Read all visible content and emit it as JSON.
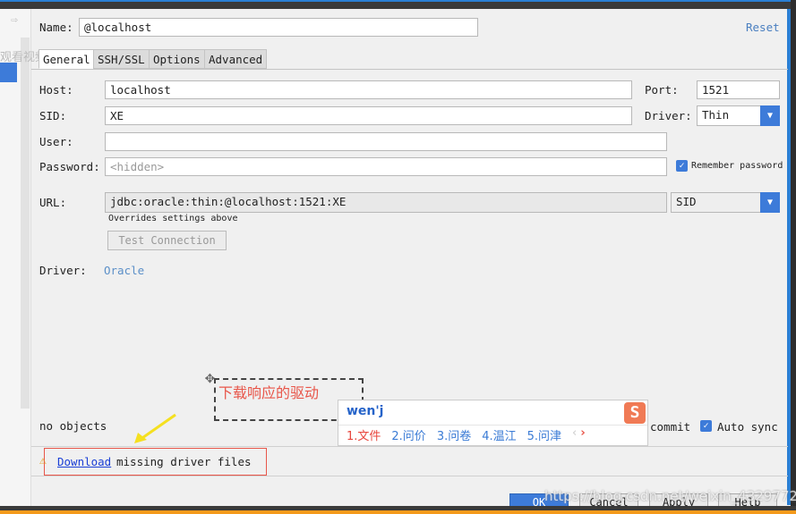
{
  "name": {
    "label": "Name:",
    "value": "@localhost",
    "reset": "Reset"
  },
  "tabs": [
    {
      "label": "General"
    },
    {
      "label": "SSH/SSL"
    },
    {
      "label": "Options"
    },
    {
      "label": "Advanced"
    }
  ],
  "watermark_left": "观看视频",
  "form": {
    "host_label": "Host:",
    "host": "localhost",
    "port_label": "Port:",
    "port": "1521",
    "sid_label": "SID:",
    "sid": "XE",
    "driver_label": "Driver:",
    "driver": "Thin",
    "user_label": "User:",
    "user": "",
    "password_label": "Password:",
    "password_placeholder": "<hidden>",
    "remember": "Remember password",
    "url_label": "URL:",
    "url": "jdbc:oracle:thin:@localhost:1521:XE",
    "url_type": "SID",
    "overrides": "Overrides settings above",
    "test": "Test Connection",
    "driver2_label": "Driver:",
    "driver2": "Oracle"
  },
  "annotation": "下载响应的驱动",
  "ime": {
    "input": "wen'j",
    "candidates": [
      "1.文件",
      "2.问价",
      "3.问卷",
      "4.温江",
      "5.问津"
    ]
  },
  "no_objects": "no objects",
  "commit": "commit",
  "auto_sync": "Auto sync",
  "download": {
    "link": "Download",
    "text": "missing driver files"
  },
  "buttons": {
    "ok": "OK",
    "cancel": "Cancel",
    "apply": "Apply",
    "help": "Help"
  },
  "url_watermark": "https://blog.csdn.net/weixin_43297727",
  "colors": {
    "accent": "#3d7bd9",
    "annotation": "#e8564a",
    "link": "#1a3fd6"
  }
}
